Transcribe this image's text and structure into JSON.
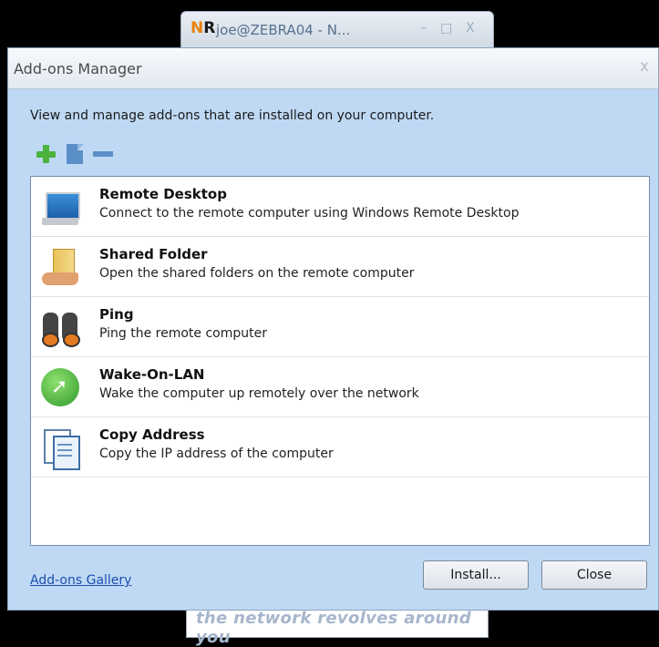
{
  "background_window": {
    "logo_n": "N",
    "logo_r": "R",
    "title": "joe@ZEBRA04 - N...",
    "minimize": "–",
    "maximize": "□",
    "close": "X",
    "footer_text": "the network revolves around you"
  },
  "dialog": {
    "title": "Add-ons Manager",
    "close": "x",
    "description": "View and manage add-ons that are installed on your computer.",
    "toolbar": [
      "add-icon",
      "edit-icon",
      "remove-icon"
    ],
    "addons": [
      {
        "name": "Remote Desktop",
        "description": "Connect to the remote computer using Windows Remote Desktop",
        "icon": "monitor-icon"
      },
      {
        "name": "Shared Folder",
        "description": "Open the shared folders on the remote computer",
        "icon": "shared-folder-icon"
      },
      {
        "name": "Ping",
        "description": "Ping the remote computer",
        "icon": "binoculars-icon"
      },
      {
        "name": "Wake-On-LAN",
        "description": "Wake the computer up remotely over the network",
        "icon": "wake-on-lan-icon"
      },
      {
        "name": "Copy Address",
        "description": "Copy the IP address of the computer",
        "icon": "copy-icon"
      }
    ],
    "gallery_link": "Add-ons Gallery",
    "install_button": "Install...",
    "close_button": "Close"
  }
}
